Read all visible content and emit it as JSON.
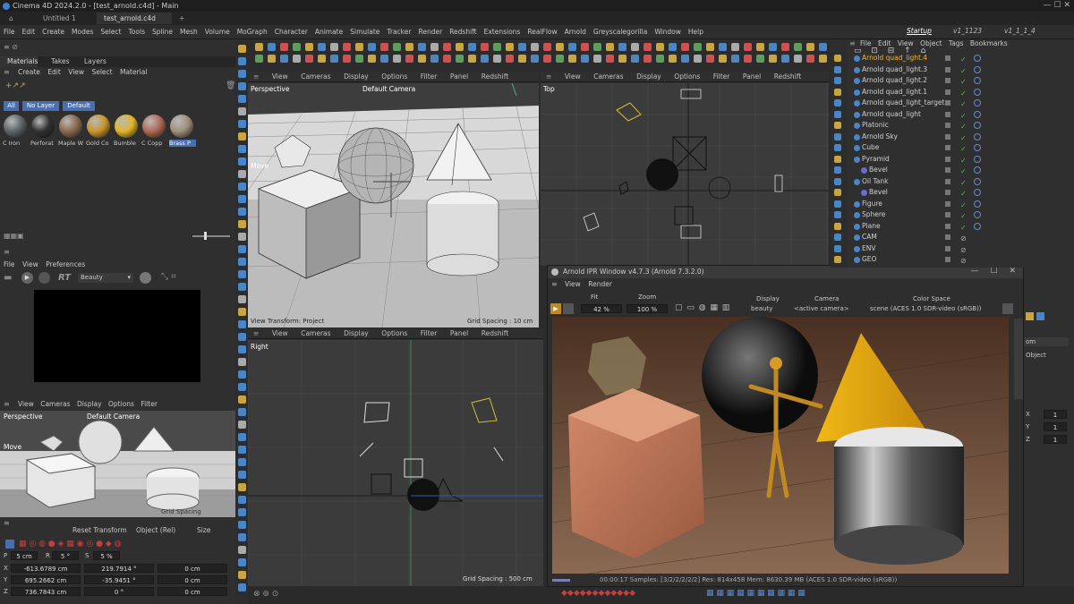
{
  "window": {
    "title": "Cinema 4D 2024.2.0 - [test_arnold.c4d] - Main"
  },
  "doc_tabs": [
    "Untitled 1",
    "test_arnold.c4d"
  ],
  "menu": [
    "File",
    "Edit",
    "Create",
    "Modes",
    "Select",
    "Tools",
    "Spline",
    "Mesh",
    "Volume",
    "MoGraph",
    "Character",
    "Animate",
    "Simulate",
    "Tracker",
    "Render",
    "Redshift",
    "Extensions",
    "RealFlow",
    "Arnold",
    "Greyscalegorilla",
    "Window",
    "Help"
  ],
  "layouts": [
    "Startup",
    "v1_1123",
    "v1_1_1_4"
  ],
  "material_panel": {
    "tabs": [
      "Materials",
      "Takes",
      "Layers"
    ],
    "menu": [
      "Create",
      "Edit",
      "View",
      "Select",
      "Material"
    ],
    "filters": [
      "All",
      "No Layer",
      "Default"
    ],
    "materials": [
      {
        "name": "C Iron",
        "color": "#5e6468"
      },
      {
        "name": "Perforat",
        "color": "#303030"
      },
      {
        "name": "Maple W",
        "color": "#8a6a4e"
      },
      {
        "name": "Gold Co",
        "color": "#c9962e"
      },
      {
        "name": "Bumble",
        "color": "#e0b528"
      },
      {
        "name": "C Copp",
        "color": "#b06a55"
      },
      {
        "name": "Brass P",
        "color": "#a0907a"
      }
    ]
  },
  "rt_panel": {
    "menu": [
      "File",
      "View",
      "Preferences"
    ],
    "label": "RT",
    "mode": "Beauty"
  },
  "small_viewport": {
    "menu": [
      "View",
      "Cameras",
      "Display",
      "Options",
      "Filter"
    ],
    "name": "Perspective",
    "camera": "Default Camera",
    "mode": "Move",
    "footer": "Grid Spacing"
  },
  "coords": {
    "reset": "Reset Transform",
    "mode": "Object (Rel)",
    "size": "Size",
    "p_label": "P",
    "p_val": "5 cm",
    "r_label": "R",
    "r_val": "5 °",
    "s_label": "S",
    "s_val": "5 %",
    "rows": [
      {
        "axis": "X",
        "pos": "-613.6789 cm",
        "rot": "219.7914 °",
        "size": "0 cm"
      },
      {
        "axis": "Y",
        "pos": "695.2662 cm",
        "rot": "-35.9451 °",
        "size": "0 cm"
      },
      {
        "axis": "Z",
        "pos": "736.7843 cm",
        "rot": "0 °",
        "size": "0 cm"
      }
    ]
  },
  "vp_menu": [
    "View",
    "Cameras",
    "Display",
    "Options",
    "Filter",
    "Panel",
    "Redshift"
  ],
  "vp_persp": {
    "name": "Perspective",
    "camera": "Default Camera",
    "mode": "Move",
    "footer_left": "View Transform: Project",
    "footer_right": "Grid Spacing : 10 cm"
  },
  "vp_top": {
    "name": "Top"
  },
  "vp_right": {
    "name": "Right",
    "footer": "Grid Spacing : 500 cm"
  },
  "ipr": {
    "title": "Arnold IPR Window v4.7.3 (Arnold 7.3.2.0)",
    "menu": [
      "View",
      "Render"
    ],
    "fit_label": "Fit",
    "fit_val": "42 %",
    "zoom_label": "Zoom",
    "zoom_val": "100 %",
    "display_label": "Display",
    "display_val": "beauty",
    "camera_label": "Camera",
    "camera_val": "<active camera>",
    "cs_label": "Color Space",
    "cs_val": "scene (ACES 1.0 SDR-video (sRGB))",
    "status": "00:00:17  Samples: [3/2/2/2/2/2]  Res: 814x458  Mem: 8630.39 MB  (ACES 1.0 SDR-video (sRGB))"
  },
  "object_manager": {
    "menu": [
      "File",
      "Edit",
      "View",
      "Object",
      "Tags",
      "Bookmarks"
    ],
    "objects": [
      {
        "name": "Arnold quad_light.4",
        "hl": true
      },
      {
        "name": "Arnold quad_light.3"
      },
      {
        "name": "Arnold quad_light.2"
      },
      {
        "name": "Arnold quad_light.1"
      },
      {
        "name": "Arnold quad_light_target"
      },
      {
        "name": "Arnold quad_light"
      },
      {
        "name": "Platonic"
      },
      {
        "name": "Arnold Sky"
      },
      {
        "name": "Cube"
      },
      {
        "name": "Pyramid"
      },
      {
        "name": "Bevel",
        "indent": true
      },
      {
        "name": "Oil Tank"
      },
      {
        "name": "Bevel",
        "indent": true
      },
      {
        "name": "Figure"
      },
      {
        "name": "Sphere"
      },
      {
        "name": "Plane"
      },
      {
        "name": "CAM"
      },
      {
        "name": "ENV"
      },
      {
        "name": "GEO"
      }
    ]
  },
  "attr": {
    "mode": "om",
    "label": "Object",
    "rows": [
      {
        "axis": "X",
        "val": "1"
      },
      {
        "axis": "Y",
        "val": "1"
      },
      {
        "axis": "Z",
        "val": "1"
      }
    ]
  }
}
